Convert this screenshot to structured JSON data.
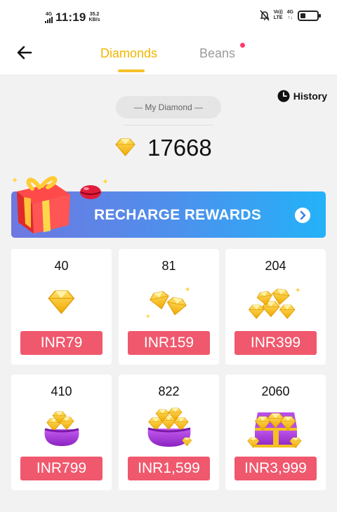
{
  "status_bar": {
    "network_type": "4G",
    "time": "11:19",
    "net_speed_value": "35.2",
    "net_speed_unit": "KB/s",
    "volte_line1": "Vo))",
    "volte_line2": "LTE",
    "right_network": "4G",
    "battery_level": 0.3
  },
  "header": {
    "tabs": [
      {
        "label": "Diamonds",
        "active": true
      },
      {
        "label": "Beans",
        "active": false,
        "has_notification_dot": true
      }
    ],
    "back_icon": "arrow-left-icon"
  },
  "balance": {
    "history_label": "History",
    "history_icon": "clock-icon",
    "caption": "— My Diamond —",
    "value": "17668"
  },
  "banner": {
    "title": "RECHARGE REWARDS"
  },
  "packages": [
    {
      "amount": "40",
      "price": "INR79",
      "icon": "single-diamond"
    },
    {
      "amount": "81",
      "price": "INR159",
      "icon": "two-diamonds"
    },
    {
      "amount": "204",
      "price": "INR399",
      "icon": "diamond-pile"
    },
    {
      "amount": "410",
      "price": "INR799",
      "icon": "small-diamond-bag"
    },
    {
      "amount": "822",
      "price": "INR1,599",
      "icon": "diamond-bag"
    },
    {
      "amount": "2060",
      "price": "INR3,999",
      "icon": "diamond-chest"
    }
  ],
  "colors": {
    "accent": "#f6c22a",
    "price_button": "#f0586d",
    "banner_start": "#6e78e0",
    "banner_end": "#23b2f8",
    "purple": "#a038d4"
  }
}
